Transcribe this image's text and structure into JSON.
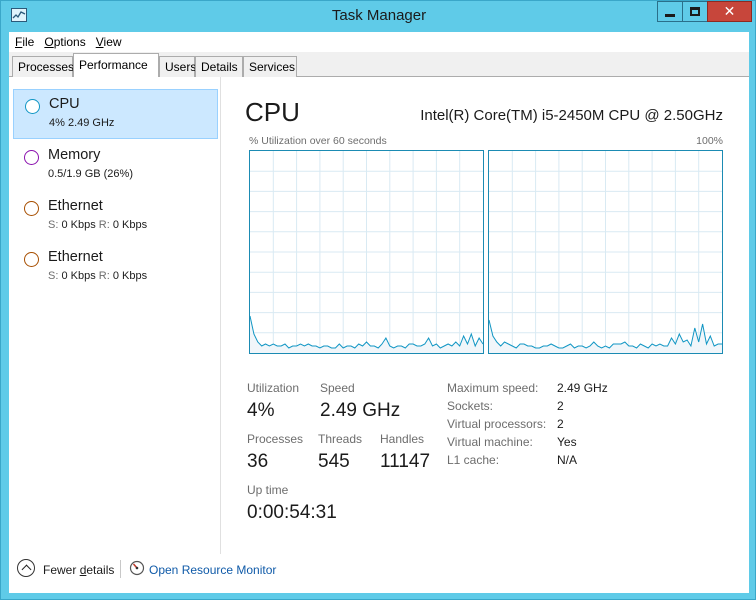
{
  "window": {
    "title": "Task Manager",
    "minimize_glyph": "",
    "maximize_glyph": "",
    "close_glyph": "✕"
  },
  "menu": [
    {
      "accel": "F",
      "rest": "ile"
    },
    {
      "accel": "O",
      "rest": "ptions"
    },
    {
      "accel": "V",
      "rest": "iew"
    }
  ],
  "tabs": [
    {
      "label": "Processes"
    },
    {
      "label": "Performance",
      "active": true
    },
    {
      "label": "Users"
    },
    {
      "label": "Details"
    },
    {
      "label": "Services"
    }
  ],
  "sidebar": {
    "items": [
      {
        "name": "CPU",
        "sub": "4% 2.49 GHz",
        "selected": true,
        "color": "#1196c4"
      },
      {
        "name": "Memory",
        "sub": "0.5/1.9 GB (26%)",
        "color": "#8b12ae"
      },
      {
        "name": "Ethernet",
        "sub_label1": "S:",
        "sub_value1": "0 Kbps",
        "sub_label2": "R:",
        "sub_value2": "0 Kbps",
        "color": "#a74f01"
      },
      {
        "name": "Ethernet",
        "sub_label1": "S:",
        "sub_value1": "0 Kbps",
        "sub_label2": "R:",
        "sub_value2": "0 Kbps",
        "color": "#a74f01"
      }
    ]
  },
  "main": {
    "title": "CPU",
    "model": "Intel(R) Core(TM) i5-2450M CPU @ 2.50GHz",
    "graph_label_left": "% Utilization over 60 seconds",
    "graph_label_right": "100%",
    "graph_color": "#1196c4",
    "stats": {
      "utilization_label": "Utilization",
      "utilization": "4%",
      "speed_label": "Speed",
      "speed": "2.49 GHz",
      "processes_label": "Processes",
      "processes": "36",
      "threads_label": "Threads",
      "threads": "545",
      "handles_label": "Handles",
      "handles": "11147",
      "uptime_label": "Up time",
      "uptime": "0:00:54:31"
    },
    "specs": [
      {
        "label": "Maximum speed:",
        "value": "2.49 GHz"
      },
      {
        "label": "Sockets:",
        "value": "2"
      },
      {
        "label": "Virtual processors:",
        "value": "2"
      },
      {
        "label": "Virtual machine:",
        "value": "Yes"
      },
      {
        "label": "L1 cache:",
        "value": "N/A"
      }
    ],
    "cpu0_history": [
      18,
      9,
      5,
      3,
      4,
      3,
      4,
      3,
      3,
      4,
      2,
      3,
      3,
      4,
      3,
      4,
      3,
      3,
      2,
      3,
      3,
      2,
      2,
      4,
      2,
      3,
      3,
      2,
      4,
      3,
      5,
      3,
      3,
      2,
      4,
      7,
      3,
      2,
      3,
      3,
      2,
      4,
      4,
      3,
      3,
      4,
      7,
      3,
      4,
      2,
      3,
      4,
      3,
      5,
      3,
      8,
      4,
      9,
      3,
      7,
      4
    ],
    "cpu1_history": [
      16,
      8,
      5,
      3,
      5,
      4,
      3,
      2,
      4,
      4,
      3,
      3,
      2,
      2,
      3,
      3,
      4,
      3,
      2,
      2,
      3,
      4,
      2,
      3,
      3,
      2,
      3,
      5,
      3,
      2,
      3,
      2,
      4,
      4,
      4,
      5,
      3,
      3,
      2,
      4,
      3,
      2,
      4,
      3,
      4,
      3,
      3,
      7,
      4,
      9,
      5,
      6,
      3,
      12,
      5,
      14,
      4,
      8,
      3,
      4,
      4
    ]
  },
  "footer": {
    "fewer_details_accel": "d",
    "fewer_details_pre": "Fewer ",
    "fewer_details_post": "etails",
    "resource_monitor": "Open Resource Monitor"
  }
}
